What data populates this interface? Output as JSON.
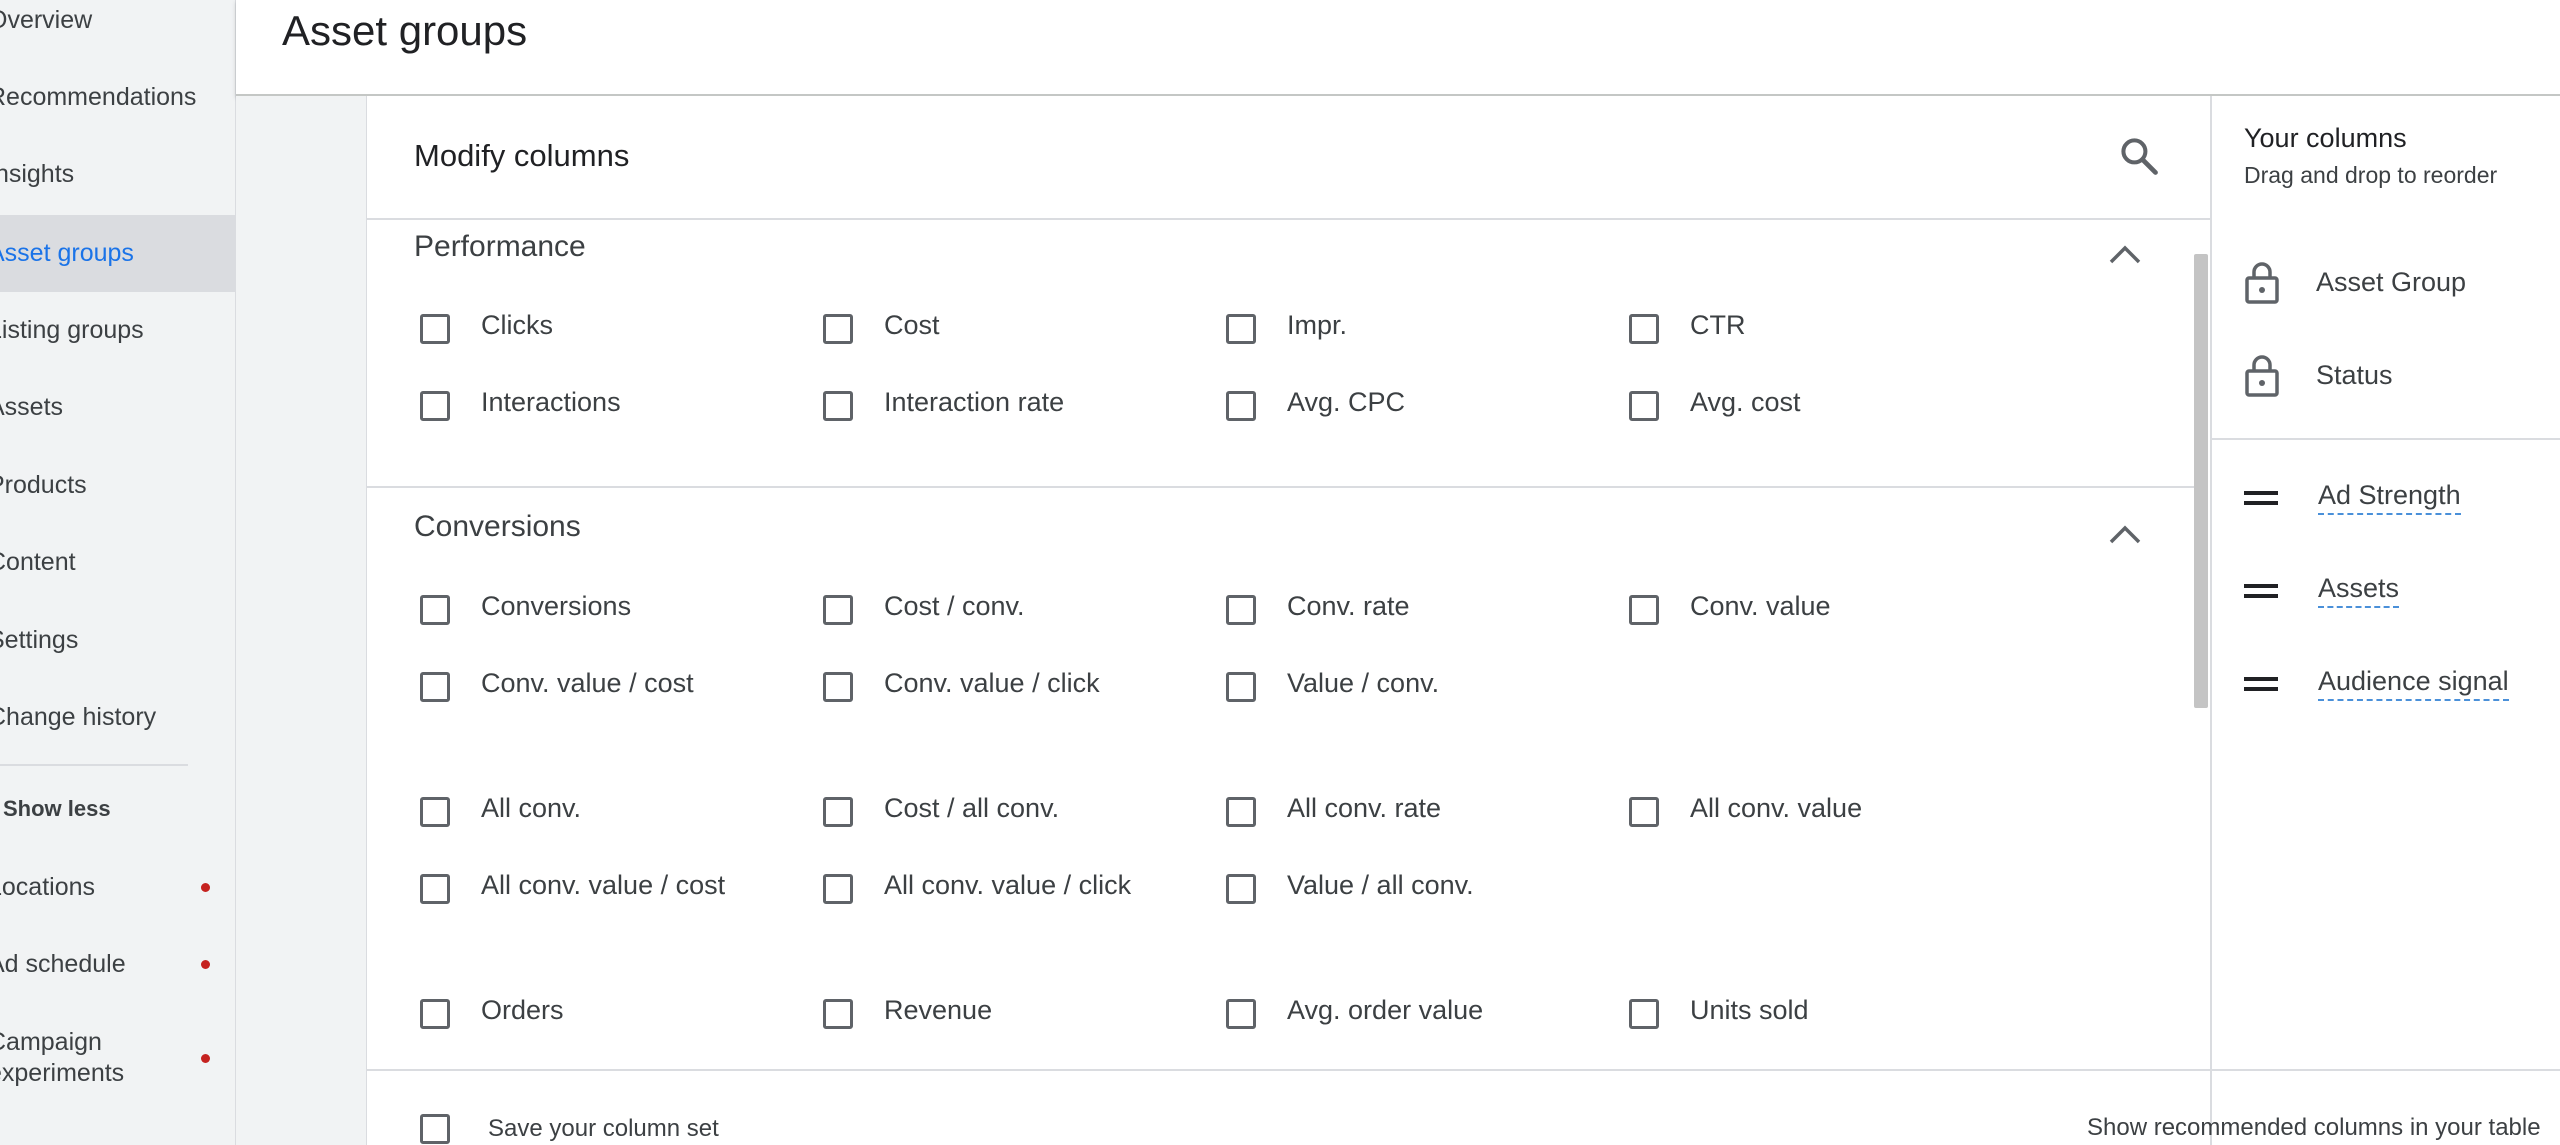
{
  "sidebar": {
    "items": [
      {
        "label": "Overview",
        "active": false,
        "dot": false
      },
      {
        "label": "Recommendations",
        "active": false,
        "dot": false
      },
      {
        "label": "Insights",
        "active": false,
        "dot": false
      },
      {
        "label": "Asset groups",
        "active": true,
        "dot": false
      },
      {
        "label": "Listing groups",
        "active": false,
        "dot": false
      },
      {
        "label": "Assets",
        "active": false,
        "dot": false
      },
      {
        "label": "Products",
        "active": false,
        "dot": false
      },
      {
        "label": "Content",
        "active": false,
        "dot": false
      },
      {
        "label": "Settings",
        "active": false,
        "dot": false
      },
      {
        "label": "Change history",
        "active": false,
        "dot": false
      }
    ],
    "show_less": "Show less",
    "extra_items": [
      {
        "label": "Locations",
        "dot": true
      },
      {
        "label": "Ad schedule",
        "dot": true
      },
      {
        "label": "Campaign experiments",
        "dot": true
      }
    ]
  },
  "page": {
    "title": "Asset groups"
  },
  "dialog": {
    "title": "Modify columns",
    "sections": [
      {
        "title": "Performance",
        "rows": [
          [
            "Clicks",
            "Cost",
            "Impr.",
            "CTR"
          ],
          [
            "Interactions",
            "Interaction rate",
            "Avg. CPC",
            "Avg. cost"
          ]
        ]
      },
      {
        "title": "Conversions",
        "rows": [
          [
            "Conversions",
            "Cost / conv.",
            "Conv. rate",
            "Conv. value"
          ],
          [
            "Conv. value / cost",
            "Conv. value / click",
            "Value / conv."
          ],
          [
            "All conv.",
            "Cost / all conv.",
            "All conv. rate",
            "All conv. value"
          ],
          [
            "All conv. value / cost",
            "All conv. value / click",
            "Value / all conv."
          ],
          [
            "Orders",
            "Revenue",
            "Avg. order value",
            "Units sold"
          ]
        ]
      }
    ]
  },
  "your_columns": {
    "title": "Your columns",
    "subtitle": "Drag and drop to reorder",
    "locked": [
      "Asset Group",
      "Status"
    ],
    "draggable": [
      "Ad Strength",
      "Assets",
      "Audience signal"
    ]
  },
  "footer": {
    "save_label": "Save your column set",
    "show_recommended": "Show recommended columns in your table"
  },
  "colors": {
    "accent": "#1a73e8",
    "sidebar_bg": "#f1f3f4",
    "active_bg": "#dadce0",
    "dot_red": "#c5221f"
  },
  "icons": {
    "search": "search-icon",
    "collapse": "chevron-up-icon",
    "locked": "lock-icon",
    "drag": "drag-handle-icon",
    "checkbox": "checkbox-unchecked-icon"
  }
}
